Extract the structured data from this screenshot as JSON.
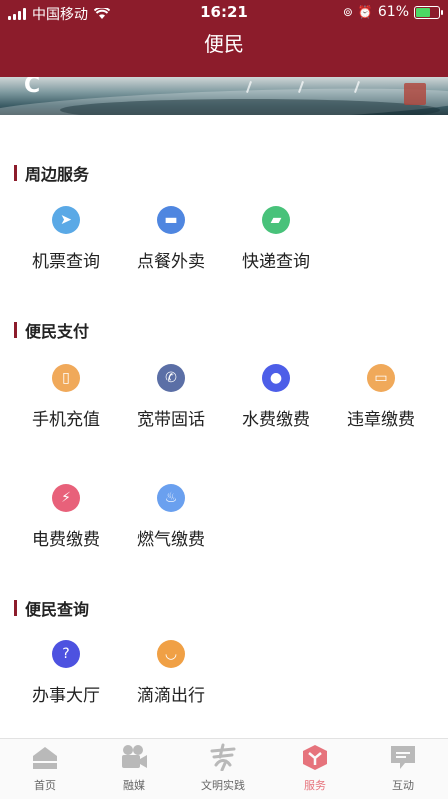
{
  "status_bar": {
    "carrier": "中国移动",
    "time": "16:21",
    "battery": "61%"
  },
  "header": {
    "title": "便民"
  },
  "banner": {
    "letter": "C"
  },
  "sections": [
    {
      "title": "周边服务",
      "items": [
        {
          "label": "机票查询",
          "icon": "plane-icon",
          "color": "#5aa9e6"
        },
        {
          "label": "点餐外卖",
          "icon": "food-icon",
          "color": "#4f86e0"
        },
        {
          "label": "快递查询",
          "icon": "truck-icon",
          "color": "#48c27a"
        }
      ]
    },
    {
      "title": "便民支付",
      "items": [
        {
          "label": "手机充值",
          "icon": "phone-icon",
          "color": "#f0a95a"
        },
        {
          "label": "宽带固话",
          "icon": "telephone-icon",
          "color": "#5b6fa6"
        },
        {
          "label": "水费缴费",
          "icon": "water-icon",
          "color": "#4d5ee8"
        },
        {
          "label": "违章缴费",
          "icon": "car-icon",
          "color": "#f0a95a"
        },
        {
          "label": "电费缴费",
          "icon": "lightning-icon",
          "color": "#e8617a"
        },
        {
          "label": "燃气缴费",
          "icon": "flame-icon",
          "color": "#6aa0ef"
        }
      ]
    },
    {
      "title": "便民查询",
      "items": [
        {
          "label": "办事大厅",
          "icon": "question-icon",
          "color": "#4d52e0"
        },
        {
          "label": "滴滴出行",
          "icon": "didi-icon",
          "color": "#f0a045"
        }
      ]
    }
  ],
  "tabbar": {
    "items": [
      {
        "label": "首页",
        "icon": "home-icon"
      },
      {
        "label": "融媒",
        "icon": "camera-icon"
      },
      {
        "label": "文明实践",
        "icon": "civilization-icon"
      },
      {
        "label": "服务",
        "icon": "service-icon",
        "active": true
      },
      {
        "label": "互动",
        "icon": "chat-icon"
      }
    ]
  }
}
